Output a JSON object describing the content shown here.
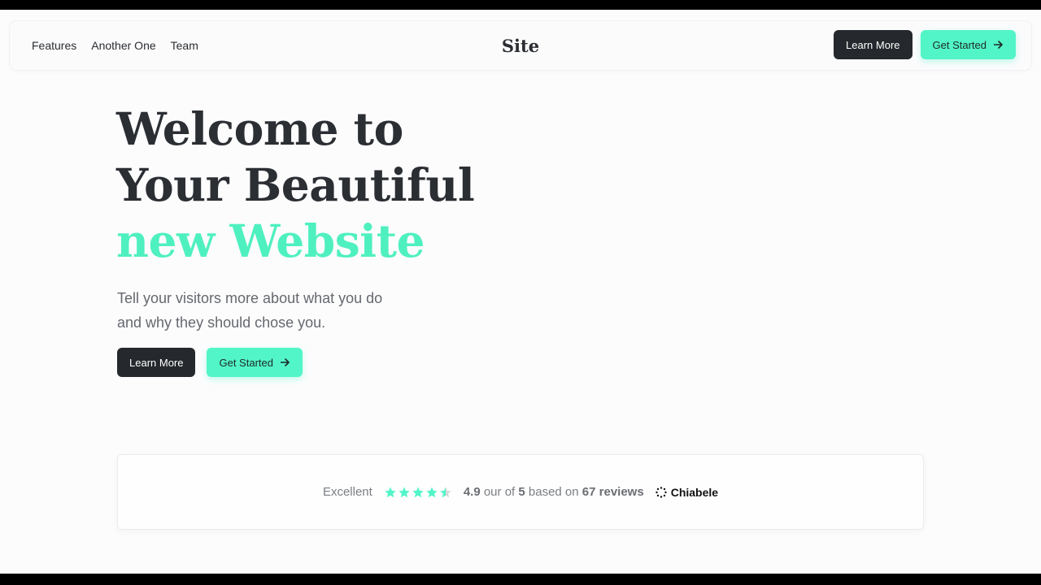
{
  "header": {
    "nav": [
      "Features",
      "Another One",
      "Team"
    ],
    "logo": "Site",
    "learn_more": "Learn More",
    "get_started": "Get Started"
  },
  "hero": {
    "title_line1": "Welcome to",
    "title_line2": "Your Beautiful",
    "title_line3": "new Website",
    "subtitle_line1": "Tell your visitors more about what you do",
    "subtitle_line2": "and why they should chose you.",
    "learn_more": "Learn More",
    "get_started": "Get Started"
  },
  "reviews": {
    "label": "Excellent",
    "rating": "4.9",
    "out_of_text": "our of",
    "max": "5",
    "based_on_text": "based on",
    "count_text": "67 reviews",
    "star_value": 4.9,
    "brand": "Chiabele"
  },
  "colors": {
    "accent": "#52f5c8",
    "dark": "#25282c",
    "title": "#2b2e33"
  },
  "icons": {
    "arrow": "arrow-right-icon",
    "star": "star-icon",
    "brand": "chiabele-logo-icon"
  }
}
